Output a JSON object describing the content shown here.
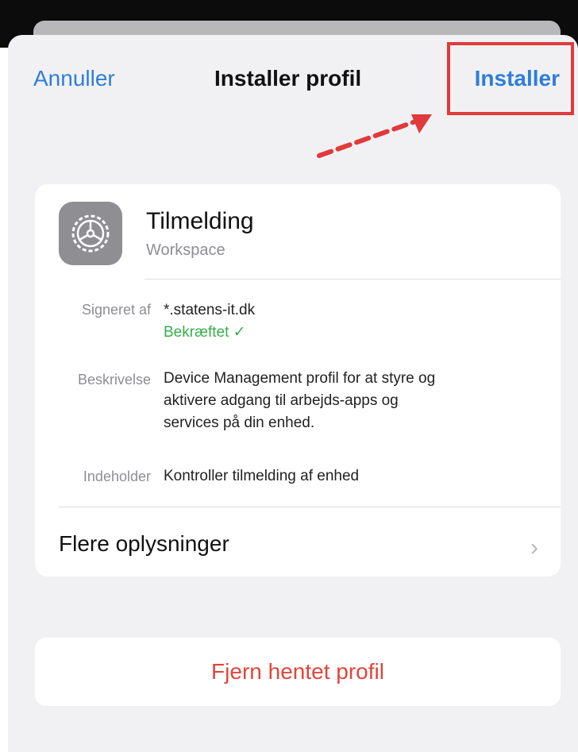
{
  "nav": {
    "cancel_label": "Annuller",
    "title": "Installer profil",
    "install_label": "Installer"
  },
  "profile": {
    "icon": "gear-icon",
    "name": "Tilmelding",
    "organization": "Workspace"
  },
  "details": {
    "signed_label": "Signeret af",
    "signed_value": "*.statens-it.dk",
    "verified_text": "Bekræftet ✓",
    "description_label": "Beskrivelse",
    "description_line1": "Device Management profil for at styre og",
    "description_line2": "aktivere adgang til arbejds-apps og",
    "description_line3": "services på din enhed.",
    "contains_label": "Indeholder",
    "contains_value": "Kontroller tilmelding af enhed"
  },
  "more": {
    "label": "Flere oplysninger",
    "chevron": "›"
  },
  "remove": {
    "label": "Fjern hentet profil"
  },
  "colors": {
    "link": "#2f7ed8",
    "highlight": "#e03a3a",
    "verified": "#34b04a",
    "destructive": "#e0463a"
  }
}
